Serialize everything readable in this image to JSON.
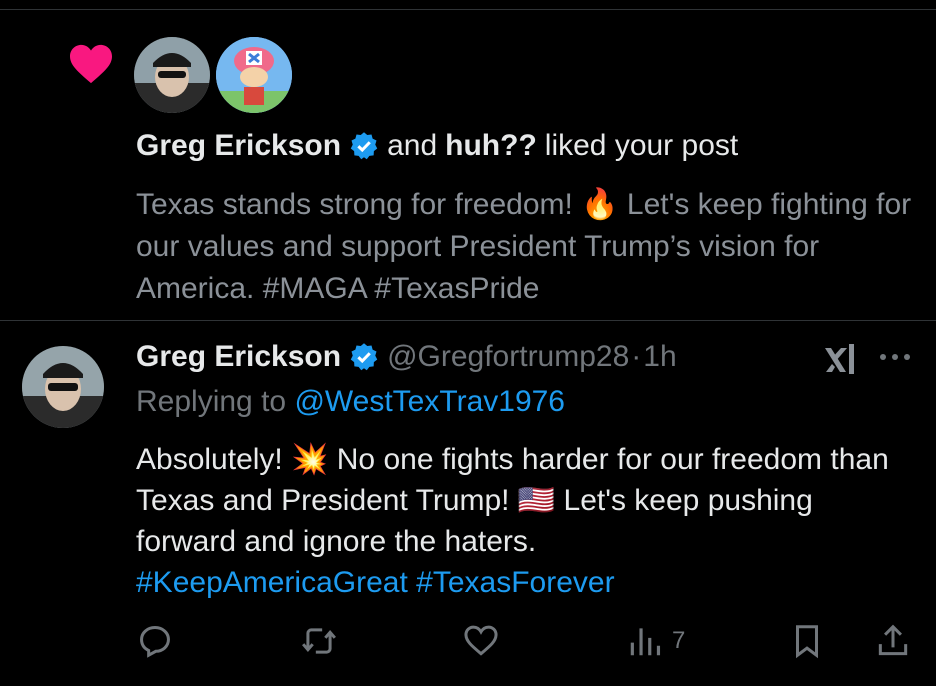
{
  "notification": {
    "user1": "Greg Erickson",
    "connector": "and",
    "user2": "huh??",
    "action": "liked your post",
    "post_text": "Texas stands strong for freedom! 🔥 Let's keep fighting for our values and support President Trump’s vision for America. #MAGA #TexasPride"
  },
  "tweet": {
    "display_name": "Greg Erickson",
    "handle": "@Gregfortrump28",
    "separator": "·",
    "time": "1h",
    "replying_label": "Replying to",
    "replying_handle": "@WestTexTrav1976",
    "body_text": "Absolutely! 💥 No one fights harder for our freedom than Texas and President Trump! 🇺🇸 Let's keep pushing forward and ignore the haters.",
    "hashtag1": "#KeepAmericaGreat",
    "hashtag2": "#TexasForever",
    "views": "7"
  },
  "icons": {
    "like_notification": "heart-icon",
    "verified": "verified-badge-icon",
    "grok": "xai-grok-icon",
    "more": "more-icon",
    "reply": "reply-icon",
    "retweet": "retweet-icon",
    "like": "like-icon",
    "views": "views-icon",
    "bookmark": "bookmark-icon",
    "share": "share-icon"
  },
  "colors": {
    "background": "#000000",
    "heart": "#f91880",
    "link": "#1d9bf0",
    "muted": "#71767b",
    "text": "#e7e9ea"
  }
}
